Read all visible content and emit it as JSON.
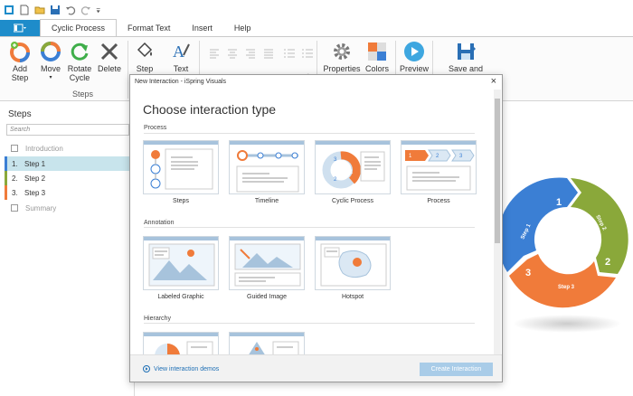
{
  "quick_access": {
    "icons": [
      "app-icon",
      "new-icon",
      "open-icon",
      "save-icon",
      "undo-icon",
      "redo-icon",
      "customize-icon"
    ]
  },
  "tabs": {
    "file_icon": "menu-icon",
    "items": [
      {
        "label": "Cyclic Process",
        "active": true
      },
      {
        "label": "Format Text",
        "active": false
      },
      {
        "label": "Insert",
        "active": false
      },
      {
        "label": "Help",
        "active": false
      }
    ]
  },
  "ribbon": {
    "add_step": "Add Step",
    "move": "Move",
    "rotate_cycle": "Rotate Cycle",
    "delete": "Delete",
    "steps_group": "Steps",
    "step": "Step",
    "text": "Text",
    "properties": "Properties",
    "colors": "Colors",
    "preview": "Preview",
    "save_return": "Save and Return"
  },
  "steps_panel": {
    "title": "Steps",
    "search_placeholder": "Search",
    "items": [
      {
        "num": "",
        "label": "Introduction",
        "type": "checkbox"
      },
      {
        "num": "1.",
        "label": "Step 1",
        "selected": true,
        "color": "#3b7fd4"
      },
      {
        "num": "2.",
        "label": "Step 2",
        "color": "#8aa83a"
      },
      {
        "num": "3.",
        "label": "Step 3",
        "color": "#f07b3a"
      },
      {
        "num": "",
        "label": "Summary",
        "type": "checkbox"
      }
    ]
  },
  "dialog": {
    "title": "New Interaction - iSpring Visuals",
    "close": "×",
    "heading": "Choose interaction type",
    "sections": [
      {
        "label": "Process",
        "tiles": [
          "Steps",
          "Timeline",
          "Cyclic Process",
          "Process"
        ]
      },
      {
        "label": "Annotation",
        "tiles": [
          "Labeled Graphic",
          "Guided Image",
          "Hotspot"
        ]
      },
      {
        "label": "Hierarchy",
        "tiles": [
          "",
          ""
        ]
      }
    ],
    "demos_link": "View interaction demos",
    "create_button": "Create Interaction"
  },
  "cycle_diagram": {
    "segments": [
      {
        "num": "1",
        "label": "Step 1",
        "color": "#3b7fd4"
      },
      {
        "num": "2",
        "label": "Step 2",
        "color": "#8aa83a"
      },
      {
        "num": "3",
        "label": "Step 3",
        "color": "#f07b3a"
      }
    ]
  },
  "colors": {
    "accent": "#1e8cca",
    "selected_row": "#c8e4ec",
    "orange": "#f07b3a",
    "tile_blue": "#a7c3dc"
  }
}
